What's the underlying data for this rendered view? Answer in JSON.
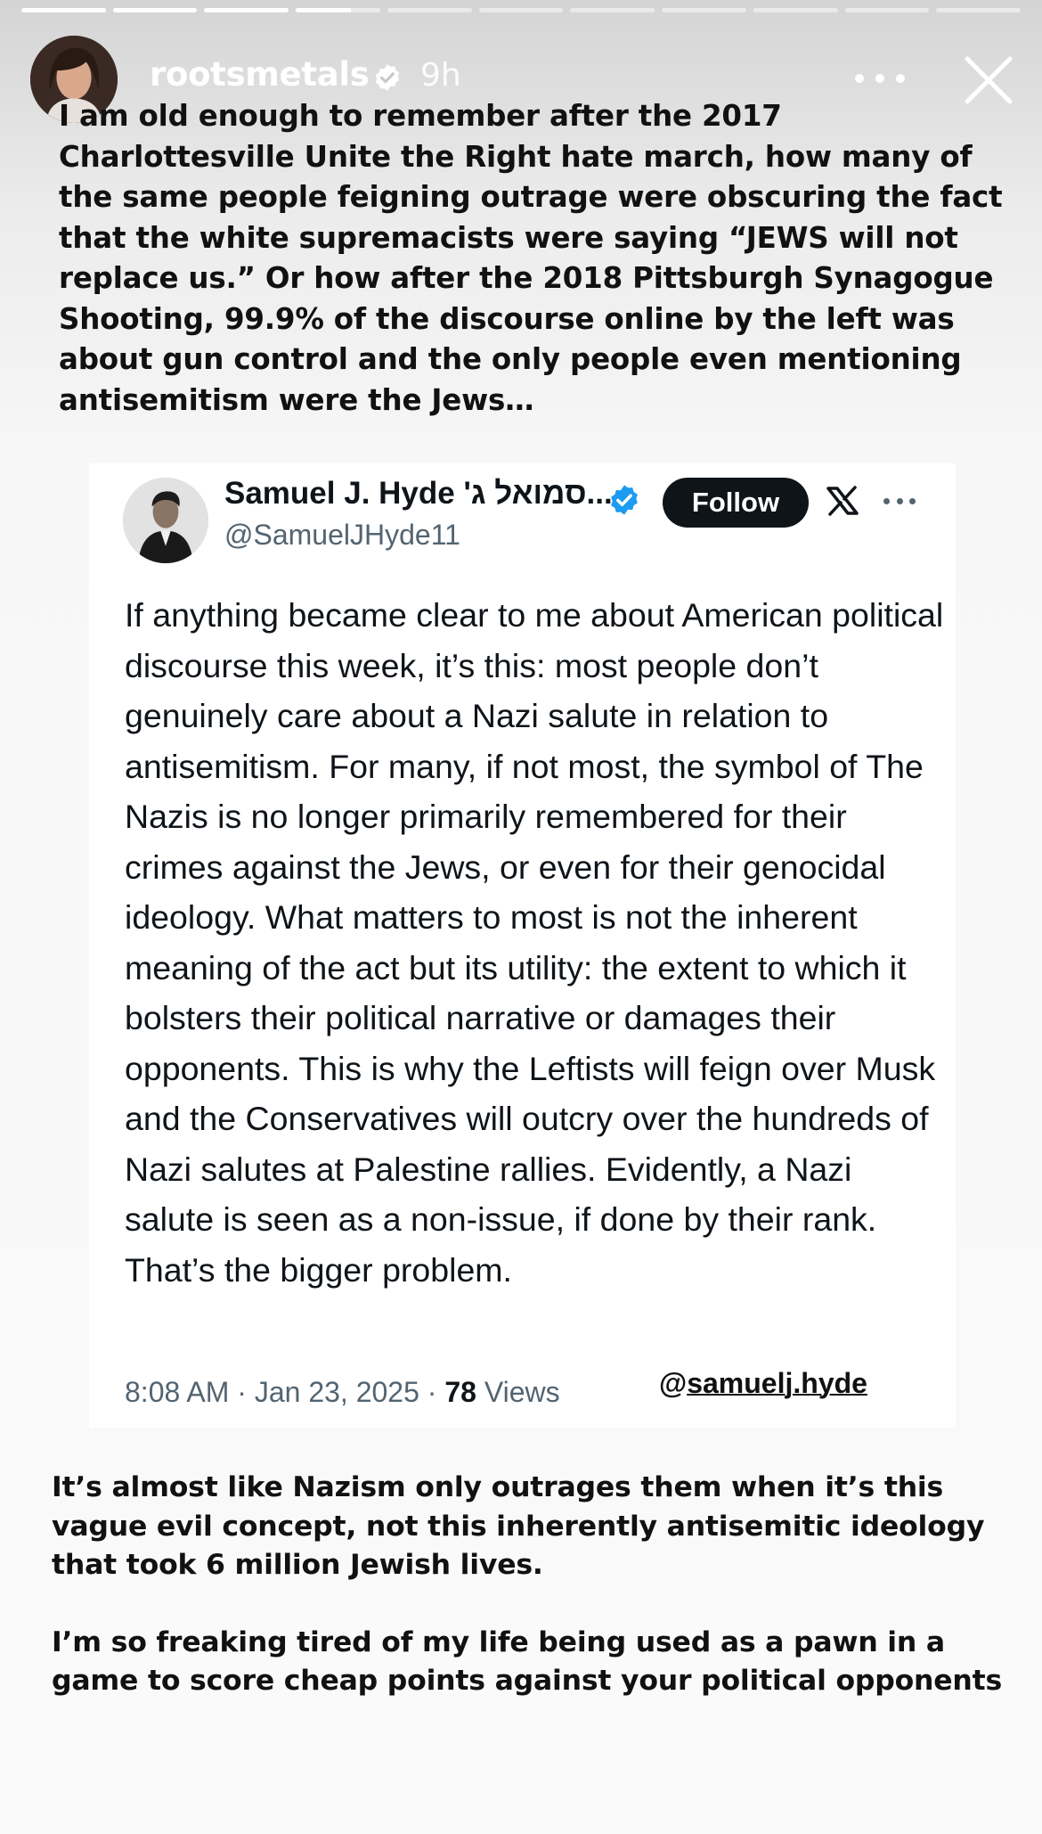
{
  "story": {
    "segments_count": 11,
    "segments": [
      1,
      1,
      1,
      0.65,
      0,
      0,
      0,
      0,
      0,
      0,
      0
    ]
  },
  "header": {
    "username": "rootsmetals",
    "time_ago": "9h"
  },
  "caption_top": "I am old enough to remember after the 2017 Charlottesville Unite the Right hate march, how many of the same people feigning outrage were obscuring the fact that the white supremacists were saying “JEWS will not replace us.” Or how after the 2018 Pittsburgh Synagogue Shooting, 99.9% of the discourse online by the left was about gun control and the only people even mentioning antisemitism were the Jews…",
  "tweet": {
    "display_name": "Samuel J. Hyde 'סמואל ג...",
    "handle": "@SamuelJHyde11",
    "follow_label": "Follow",
    "body": "If anything became clear to me about American political discourse this week, it’s this: most people don’t genuinely care about a Nazi salute in relation to antisemitism. For many, if not most, the symbol of The Nazis is no longer primarily remembered for their crimes against the Jews, or even for their genocidal ideology. What matters to most is not the inherent meaning of the act but its utility: the extent to which it bolsters their political narrative or damages their opponents. This is why the Leftists will feign over Musk and the Conservatives will outcry over the hundreds of Nazi salutes at Palestine rallies. Evidently, a Nazi salute is seen as a non-issue, if done by their rank. That’s the bigger problem.",
    "timestamp": "8:08 AM · Jan 23, 2025 · ",
    "views_count": "78",
    "views_label": " Views",
    "mention_at": "@",
    "mention_name": "samuelj.hyde"
  },
  "caption_bottom": {
    "p1": "It’s almost like Nazism only outrages them when it’s this vague evil concept, not this inherently antisemitic ideology that took 6 million Jewish lives.",
    "p2": "I’m so freaking tired of my life being used as a pawn in a game to score cheap points against your political opponents"
  },
  "colors": {
    "verified_blue": "#1d9bf0",
    "text_dark": "#0f1419",
    "text_muted": "#536471"
  },
  "icons": {
    "verified": "verified-badge-icon",
    "more": "more-options-icon",
    "close": "close-icon",
    "x": "x-logo-icon"
  }
}
